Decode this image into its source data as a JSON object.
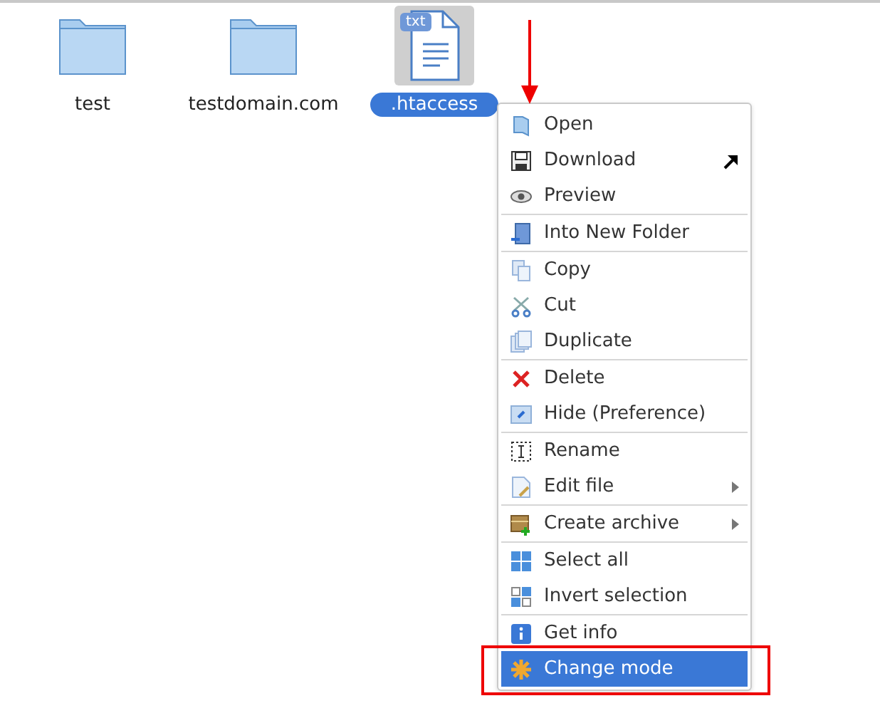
{
  "files": [
    {
      "kind": "folder",
      "name": "test",
      "selected": false
    },
    {
      "kind": "folder",
      "name": "testdomain.com",
      "selected": false
    },
    {
      "kind": "file",
      "name": ".htaccess",
      "badge": "txt",
      "selected": true
    }
  ],
  "context_menu": {
    "groups": [
      [
        {
          "label": "Open",
          "external": false,
          "submenu": false,
          "selected": false
        },
        {
          "label": "Download",
          "external": true,
          "submenu": false,
          "selected": false
        },
        {
          "label": "Preview",
          "external": false,
          "submenu": false,
          "selected": false
        }
      ],
      [
        {
          "label": "Into New Folder",
          "external": false,
          "submenu": false,
          "selected": false
        }
      ],
      [
        {
          "label": "Copy",
          "external": false,
          "submenu": false,
          "selected": false
        },
        {
          "label": "Cut",
          "external": false,
          "submenu": false,
          "selected": false
        },
        {
          "label": "Duplicate",
          "external": false,
          "submenu": false,
          "selected": false
        }
      ],
      [
        {
          "label": "Delete",
          "external": false,
          "submenu": false,
          "selected": false
        },
        {
          "label": "Hide (Preference)",
          "external": false,
          "submenu": false,
          "selected": false
        }
      ],
      [
        {
          "label": "Rename",
          "external": false,
          "submenu": false,
          "selected": false
        },
        {
          "label": "Edit file",
          "external": false,
          "submenu": true,
          "selected": false
        }
      ],
      [
        {
          "label": "Create archive",
          "external": false,
          "submenu": true,
          "selected": false
        }
      ],
      [
        {
          "label": "Select all",
          "external": false,
          "submenu": false,
          "selected": false
        },
        {
          "label": "Invert selection",
          "external": false,
          "submenu": false,
          "selected": false
        }
      ],
      [
        {
          "label": "Get info",
          "external": false,
          "submenu": false,
          "selected": false
        },
        {
          "label": "Change mode",
          "external": false,
          "submenu": false,
          "selected": true
        }
      ]
    ]
  }
}
